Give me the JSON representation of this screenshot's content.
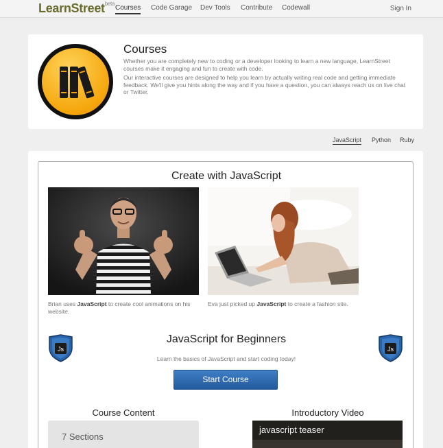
{
  "nav": {
    "logo": "LearnStreet",
    "logo_sup": "beta",
    "links": [
      "Courses",
      "Code Garage",
      "Dev Tools",
      "Contribute",
      "Codewall"
    ],
    "signin": "Sign In"
  },
  "hero": {
    "title": "Courses",
    "p1": "Whether you are completely new to coding or a developer looking to learn a new language, LearnStreet courses make it engaging and fun to create with code.",
    "p2": "Our interactive courses are designed to help you learn by actually writing real code and getting immediate feedback. We'll give you hints along the way and if you have a question, you can always reach us on live chat or Twitter."
  },
  "lang_tabs": [
    "JavaScript",
    "Python",
    "Ruby"
  ],
  "main": {
    "create_title": "Create with JavaScript",
    "caption1_pre": "Brian uses ",
    "caption1_bold": "JavaScript",
    "caption1_post": " to create cool animations on his website.",
    "caption2_pre": "Eva just picked up ",
    "caption2_bold": "JavaScript",
    "caption2_post": " to create a fashion site.",
    "shield_label": "Js",
    "course_title": "JavaScript for Beginners",
    "course_sub": "Learn the basics of JavaScript and start coding today!",
    "start_button": "Start Course",
    "content_title": "Course Content",
    "sections": "7 Sections",
    "video_title": "Introductory Video",
    "video_caption": "javascript teaser"
  },
  "colors": {
    "accent_button": "#2f6db5",
    "logo": "#6b6b2f",
    "badge": "#f5a60c"
  }
}
